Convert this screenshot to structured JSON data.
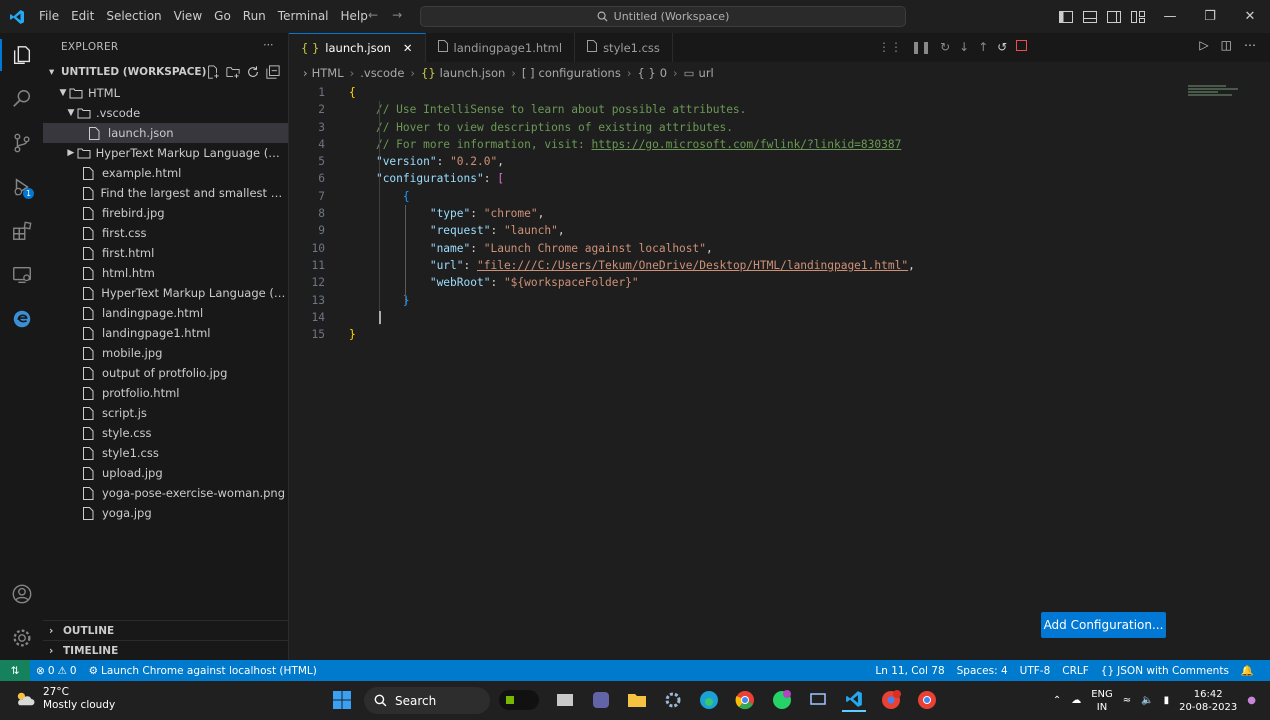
{
  "titlebar": {
    "menu": [
      "File",
      "Edit",
      "Selection",
      "View",
      "Go",
      "Run",
      "Terminal",
      "Help"
    ],
    "command_center": "Untitled (Workspace)"
  },
  "sidebar": {
    "title": "EXPLORER",
    "workspace": "UNTITLED (WORKSPACE)",
    "root_folder": "HTML",
    "subfolder": ".vscode",
    "selected_file": "launch.json",
    "collapsed_folder": "HyperText Markup Language (HT...",
    "files": [
      "example.html",
      "Find the largest and smallest elem...",
      "firebird.jpg",
      "first.css",
      "first.html",
      "html.htm",
      "HyperText Markup Language (HT...",
      "landingpage.html",
      "landingpage1.html",
      "mobile.jpg",
      "output of protfolio.jpg",
      "protfolio.html",
      "script.js",
      "style.css",
      "style1.css",
      "upload.jpg",
      "yoga-pose-exercise-woman.png",
      "yoga.jpg"
    ],
    "outline": "OUTLINE",
    "timeline": "TIMELINE"
  },
  "tabs": [
    {
      "label": "launch.json",
      "active": true
    },
    {
      "label": "landingpage1.html",
      "active": false
    },
    {
      "label": "style1.css",
      "active": false
    }
  ],
  "breadcrumb": [
    "HTML",
    ".vscode",
    "launch.json",
    "configurations",
    "0",
    "url"
  ],
  "code": {
    "l1": "{",
    "l2": "// Use IntelliSense to learn about possible attributes.",
    "l3": "// Hover to view descriptions of existing attributes.",
    "l4_prefix": "// For more information, visit: ",
    "l4_link": "https://go.microsoft.com/fwlink/?linkid=830387",
    "l5_key": "\"version\"",
    "l5_val": "\"0.2.0\"",
    "l6_key": "\"configurations\"",
    "l7": "{",
    "l8_key": "\"type\"",
    "l8_val": "\"chrome\"",
    "l9_key": "\"request\"",
    "l9_val": "\"launch\"",
    "l10_key": "\"name\"",
    "l10_val": "\"Launch Chrome against localhost\"",
    "l11_key": "\"url\"",
    "l11_val": "\"file:///C:/Users/Tekum/OneDrive/Desktop/HTML/landingpage1.html\"",
    "l12_key": "\"webRoot\"",
    "l12_val": "\"${workspaceFolder}\"",
    "l13": "}",
    "l15": "}"
  },
  "add_configuration": "Add Configuration...",
  "statusbar": {
    "errors": "0",
    "warnings": "0",
    "launch": "Launch Chrome against localhost (HTML)",
    "position": "Ln 11, Col 78",
    "spaces": "Spaces: 4",
    "encoding": "UTF-8",
    "eol": "CRLF",
    "language": "JSON with Comments"
  },
  "taskbar": {
    "temp": "27°C",
    "weather": "Mostly cloudy",
    "search": "Search",
    "lang1": "ENG",
    "lang2": "IN",
    "time": "16:42",
    "date": "20-08-2023"
  },
  "colors": {
    "accent": "#0078d4",
    "statusbar": "#007acc",
    "remote": "#16825d",
    "comment": "#6a9955",
    "key": "#9cdcfe",
    "string": "#ce9178"
  }
}
